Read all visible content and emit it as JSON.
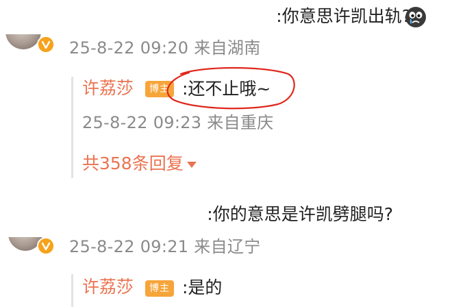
{
  "comments": [
    {
      "text": ":你意思许凯出轨?",
      "emoji": "crying-face-emoji",
      "time": "25-8-22 09:20 来自湖南",
      "reply": {
        "user": "许荔莎",
        "badge": "博主",
        "text": ":还不止哦~",
        "time": "25-8-22 09:23 来自重庆"
      },
      "more_replies": "共358条回复"
    },
    {
      "text": ":你的意思是许凯劈腿吗?",
      "time": "25-8-22 09:21 来自辽宁",
      "reply": {
        "user": "许荔莎",
        "badge": "博主",
        "text": ":是的"
      }
    }
  ],
  "colors": {
    "username": "#eb7350",
    "badge": "#f6a53a",
    "meta": "#8a8a8a",
    "annotation_circle": "#e0261c"
  }
}
